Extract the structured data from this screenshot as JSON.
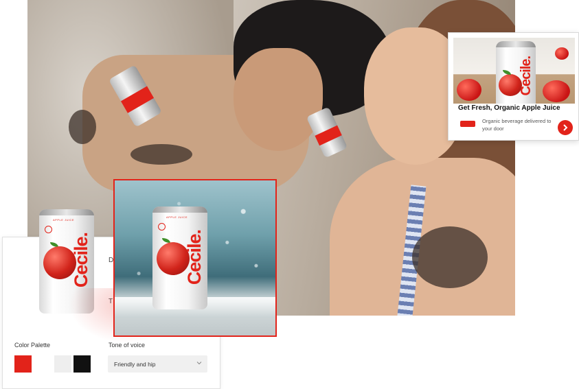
{
  "ad": {
    "title": "Get Fresh, Organic Apple Juice",
    "description": "Organic beverage delivered to your door",
    "cta_icon": "chevron-right-icon"
  },
  "brand_panel": {
    "color_palette_label": "Color Palette",
    "tone_of_voice_label": "Tone of voice",
    "tone_of_voice_value": "Friendly and hip",
    "partial_label_1": "D",
    "partial_label_2": "T",
    "palette": [
      "#e2231a",
      "#ffffff",
      "#eeeeee",
      "#111111"
    ]
  },
  "product": {
    "brand_name": "Cecile.",
    "flavor": "APPLE JUICE"
  },
  "colors": {
    "accent": "#e2231a"
  }
}
